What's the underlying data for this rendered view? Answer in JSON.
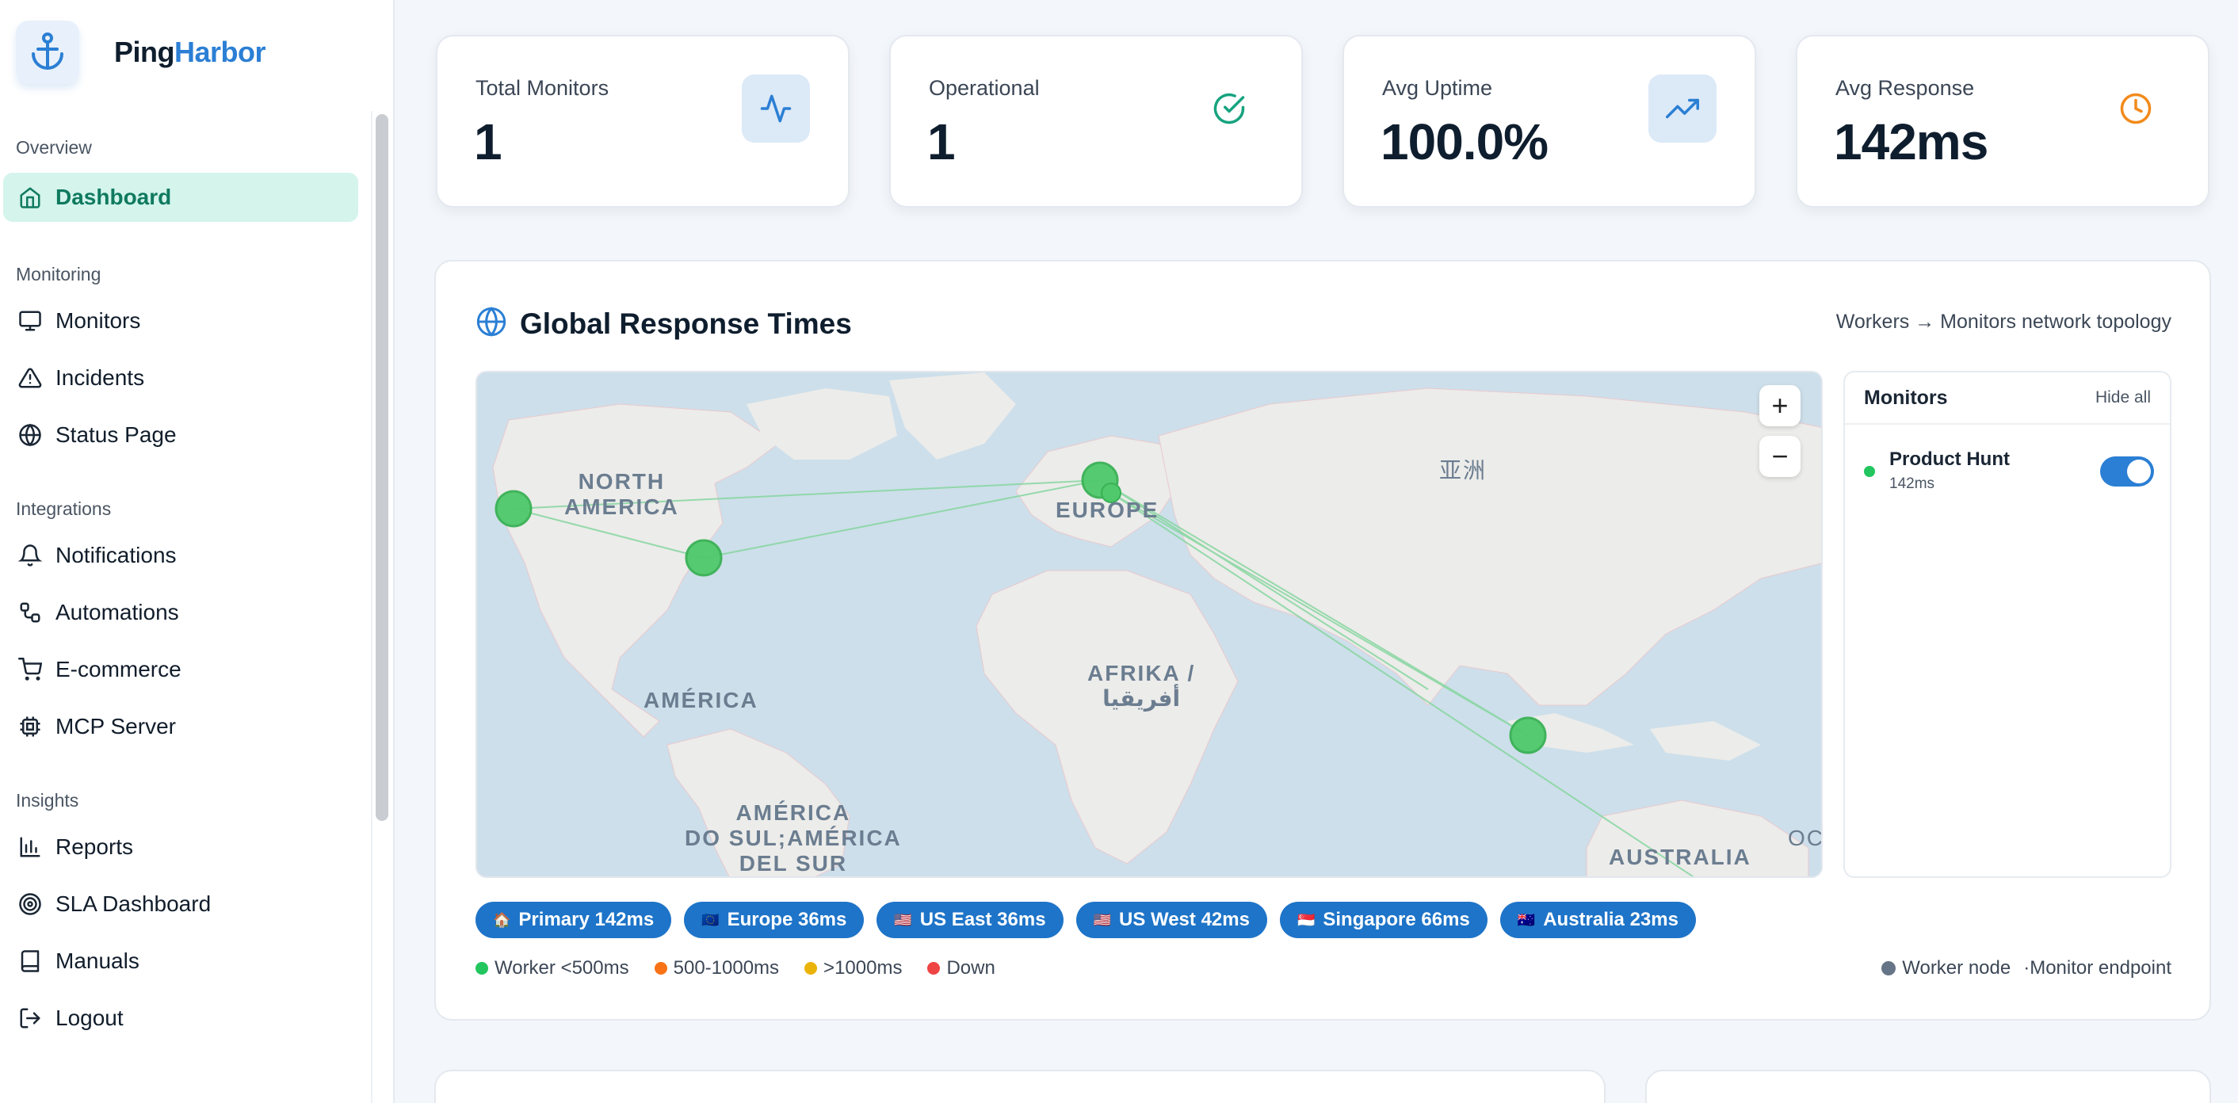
{
  "brand": {
    "name_part1": "Ping",
    "name_part2": "Harbor"
  },
  "sidebar": {
    "sections": [
      {
        "title": "Overview",
        "items": [
          {
            "label": "Dashboard",
            "icon": "home-icon",
            "active": true
          }
        ]
      },
      {
        "title": "Monitoring",
        "items": [
          {
            "label": "Monitors",
            "icon": "monitor-icon"
          },
          {
            "label": "Incidents",
            "icon": "warning-icon"
          },
          {
            "label": "Status Page",
            "icon": "globe-icon"
          }
        ]
      },
      {
        "title": "Integrations",
        "items": [
          {
            "label": "Notifications",
            "icon": "bell-icon"
          },
          {
            "label": "Automations",
            "icon": "workflow-icon"
          },
          {
            "label": "E-commerce",
            "icon": "cart-icon"
          },
          {
            "label": "MCP Server",
            "icon": "chip-icon"
          }
        ]
      },
      {
        "title": "Insights",
        "items": [
          {
            "label": "Reports",
            "icon": "bar-chart-icon"
          },
          {
            "label": "SLA Dashboard",
            "icon": "target-icon"
          },
          {
            "label": "Manuals",
            "icon": "book-icon"
          },
          {
            "label": "Logout",
            "icon": "logout-icon"
          }
        ]
      }
    ]
  },
  "stats": [
    {
      "label": "Total Monitors",
      "value": "1",
      "icon": "activity-icon"
    },
    {
      "label": "Operational",
      "value": "1",
      "icon": "check-circle-icon"
    },
    {
      "label": "Avg Uptime",
      "value": "100.0%",
      "icon": "trending-up-icon"
    },
    {
      "label": "Avg Response",
      "value": "142ms",
      "icon": "clock-icon"
    }
  ],
  "panel": {
    "title": "Global Response Times",
    "subtitle": "Workers → Monitors network topology",
    "map_labels": {
      "north_america": "NORTH\nAMERICA",
      "europe": "EUROPE",
      "asia": "亚洲",
      "africa": "AFRIKA /\nأفريقيا",
      "america": "AMÉRICA",
      "south_america": "AMÉRICA\nDO SUL;AMÉRICA\nDEL SUR",
      "australia": "AUSTRALIA",
      "ocean": "OC"
    },
    "zoom_in": "+",
    "zoom_out": "−",
    "monitors_panel": {
      "title": "Monitors",
      "hide_all": "Hide all",
      "items": [
        {
          "name": "Product Hunt",
          "response": "142ms",
          "enabled": true
        }
      ]
    },
    "workers": [
      {
        "flag": "🏠",
        "label": "Primary 142ms"
      },
      {
        "flag": "🇪🇺",
        "label": "Europe 36ms"
      },
      {
        "flag": "🇺🇸",
        "label": "US East 36ms"
      },
      {
        "flag": "🇺🇸",
        "label": "US West 42ms"
      },
      {
        "flag": "🇸🇬",
        "label": "Singapore 66ms"
      },
      {
        "flag": "🇦🇺",
        "label": "Australia 23ms"
      }
    ],
    "legend": [
      {
        "label": "Worker <500ms",
        "color": "#22c55e"
      },
      {
        "label": "500-1000ms",
        "color": "#f97316"
      },
      {
        "label": ">1000ms",
        "color": "#eab308"
      },
      {
        "label": "Down",
        "color": "#ef4444"
      }
    ],
    "legend_right": {
      "worker_node": "Worker node",
      "monitor_endpoint": "·Monitor endpoint"
    }
  },
  "colors": {
    "accent": "#2b7fd4",
    "active_bg": "#d4f4ec",
    "active_text": "#0f7a5f",
    "chip": "#1e74c8",
    "ok": "#22c55e"
  }
}
